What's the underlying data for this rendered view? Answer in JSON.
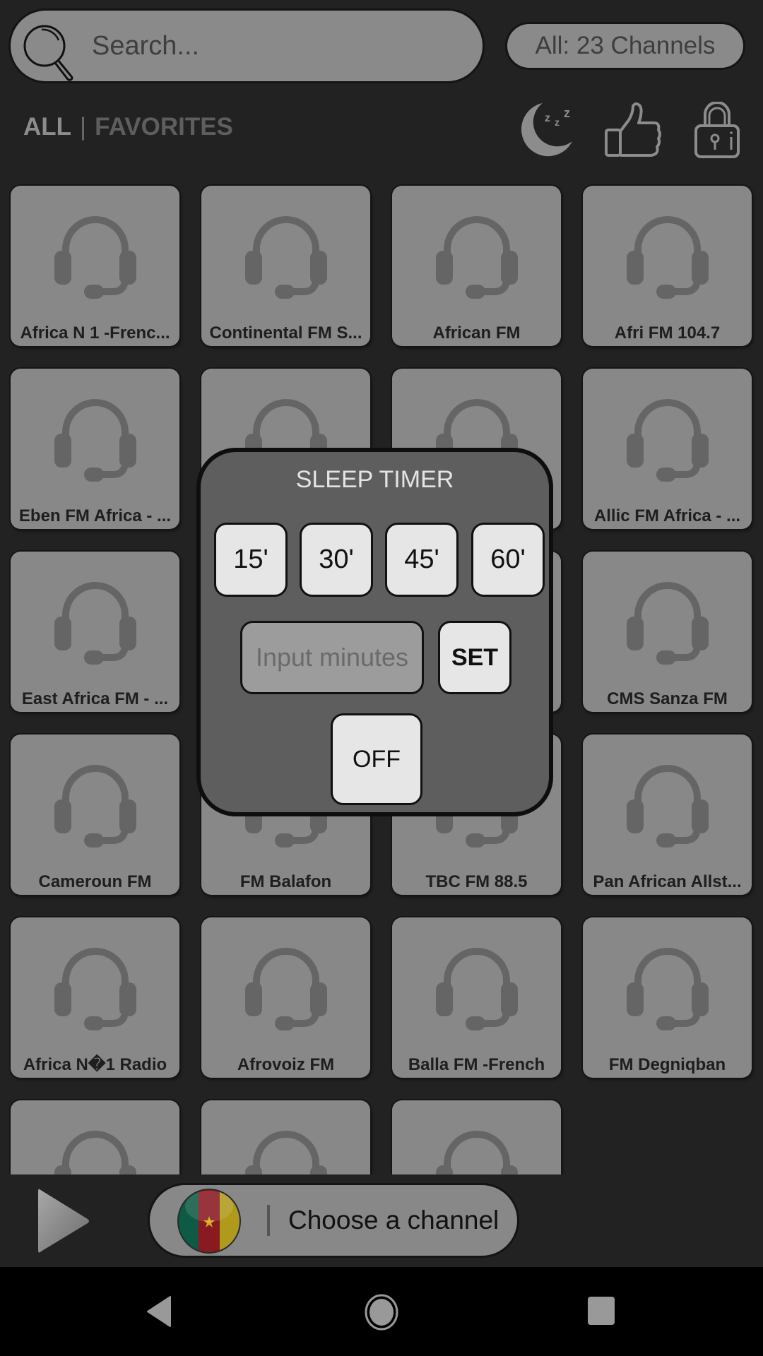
{
  "search": {
    "placeholder": "Search...",
    "icon": "search-icon"
  },
  "channel_count": "All: 23 Channels",
  "tabs": {
    "all": "ALL",
    "separator": "|",
    "favorites": "FAVORITES",
    "active": "ALL"
  },
  "top_icons": [
    "sleep-timer-icon",
    "thumbs-up-icon",
    "lock-icon"
  ],
  "channels": [
    "Africa N 1 -Frenc...",
    "Continental FM S...",
    "African FM",
    "Afri  FM 104.7",
    "Eben FM Africa - ...",
    "",
    "",
    "Allic FM Africa - ...",
    "East Africa FM - ...",
    "",
    "",
    "CMS Sanza FM",
    "Cameroun FM",
    "FM Balafon",
    "TBC  FM 88.5",
    "Pan African Allst...",
    "Africa N�1 Radio",
    "Afrovoiz FM",
    "Balla FM -French",
    "FM Degniqban",
    "",
    "",
    ""
  ],
  "sleep_timer": {
    "title": "SLEEP TIMER",
    "presets": [
      "15'",
      "30'",
      "45'",
      "60'"
    ],
    "input_placeholder": "Input minutes",
    "set_label": "SET",
    "off_label": "OFF"
  },
  "player": {
    "status": "Choose a channel",
    "flag": "cameroon-flag",
    "flag_colors": {
      "green": "#0e5a44",
      "red": "#8a1a22",
      "yellow": "#b09a1c",
      "star": "#d4b11a"
    }
  },
  "colors": {
    "background": "#222222",
    "card": "#888888",
    "dialog": "#5e5e5e",
    "button": "#e6e6e6"
  }
}
